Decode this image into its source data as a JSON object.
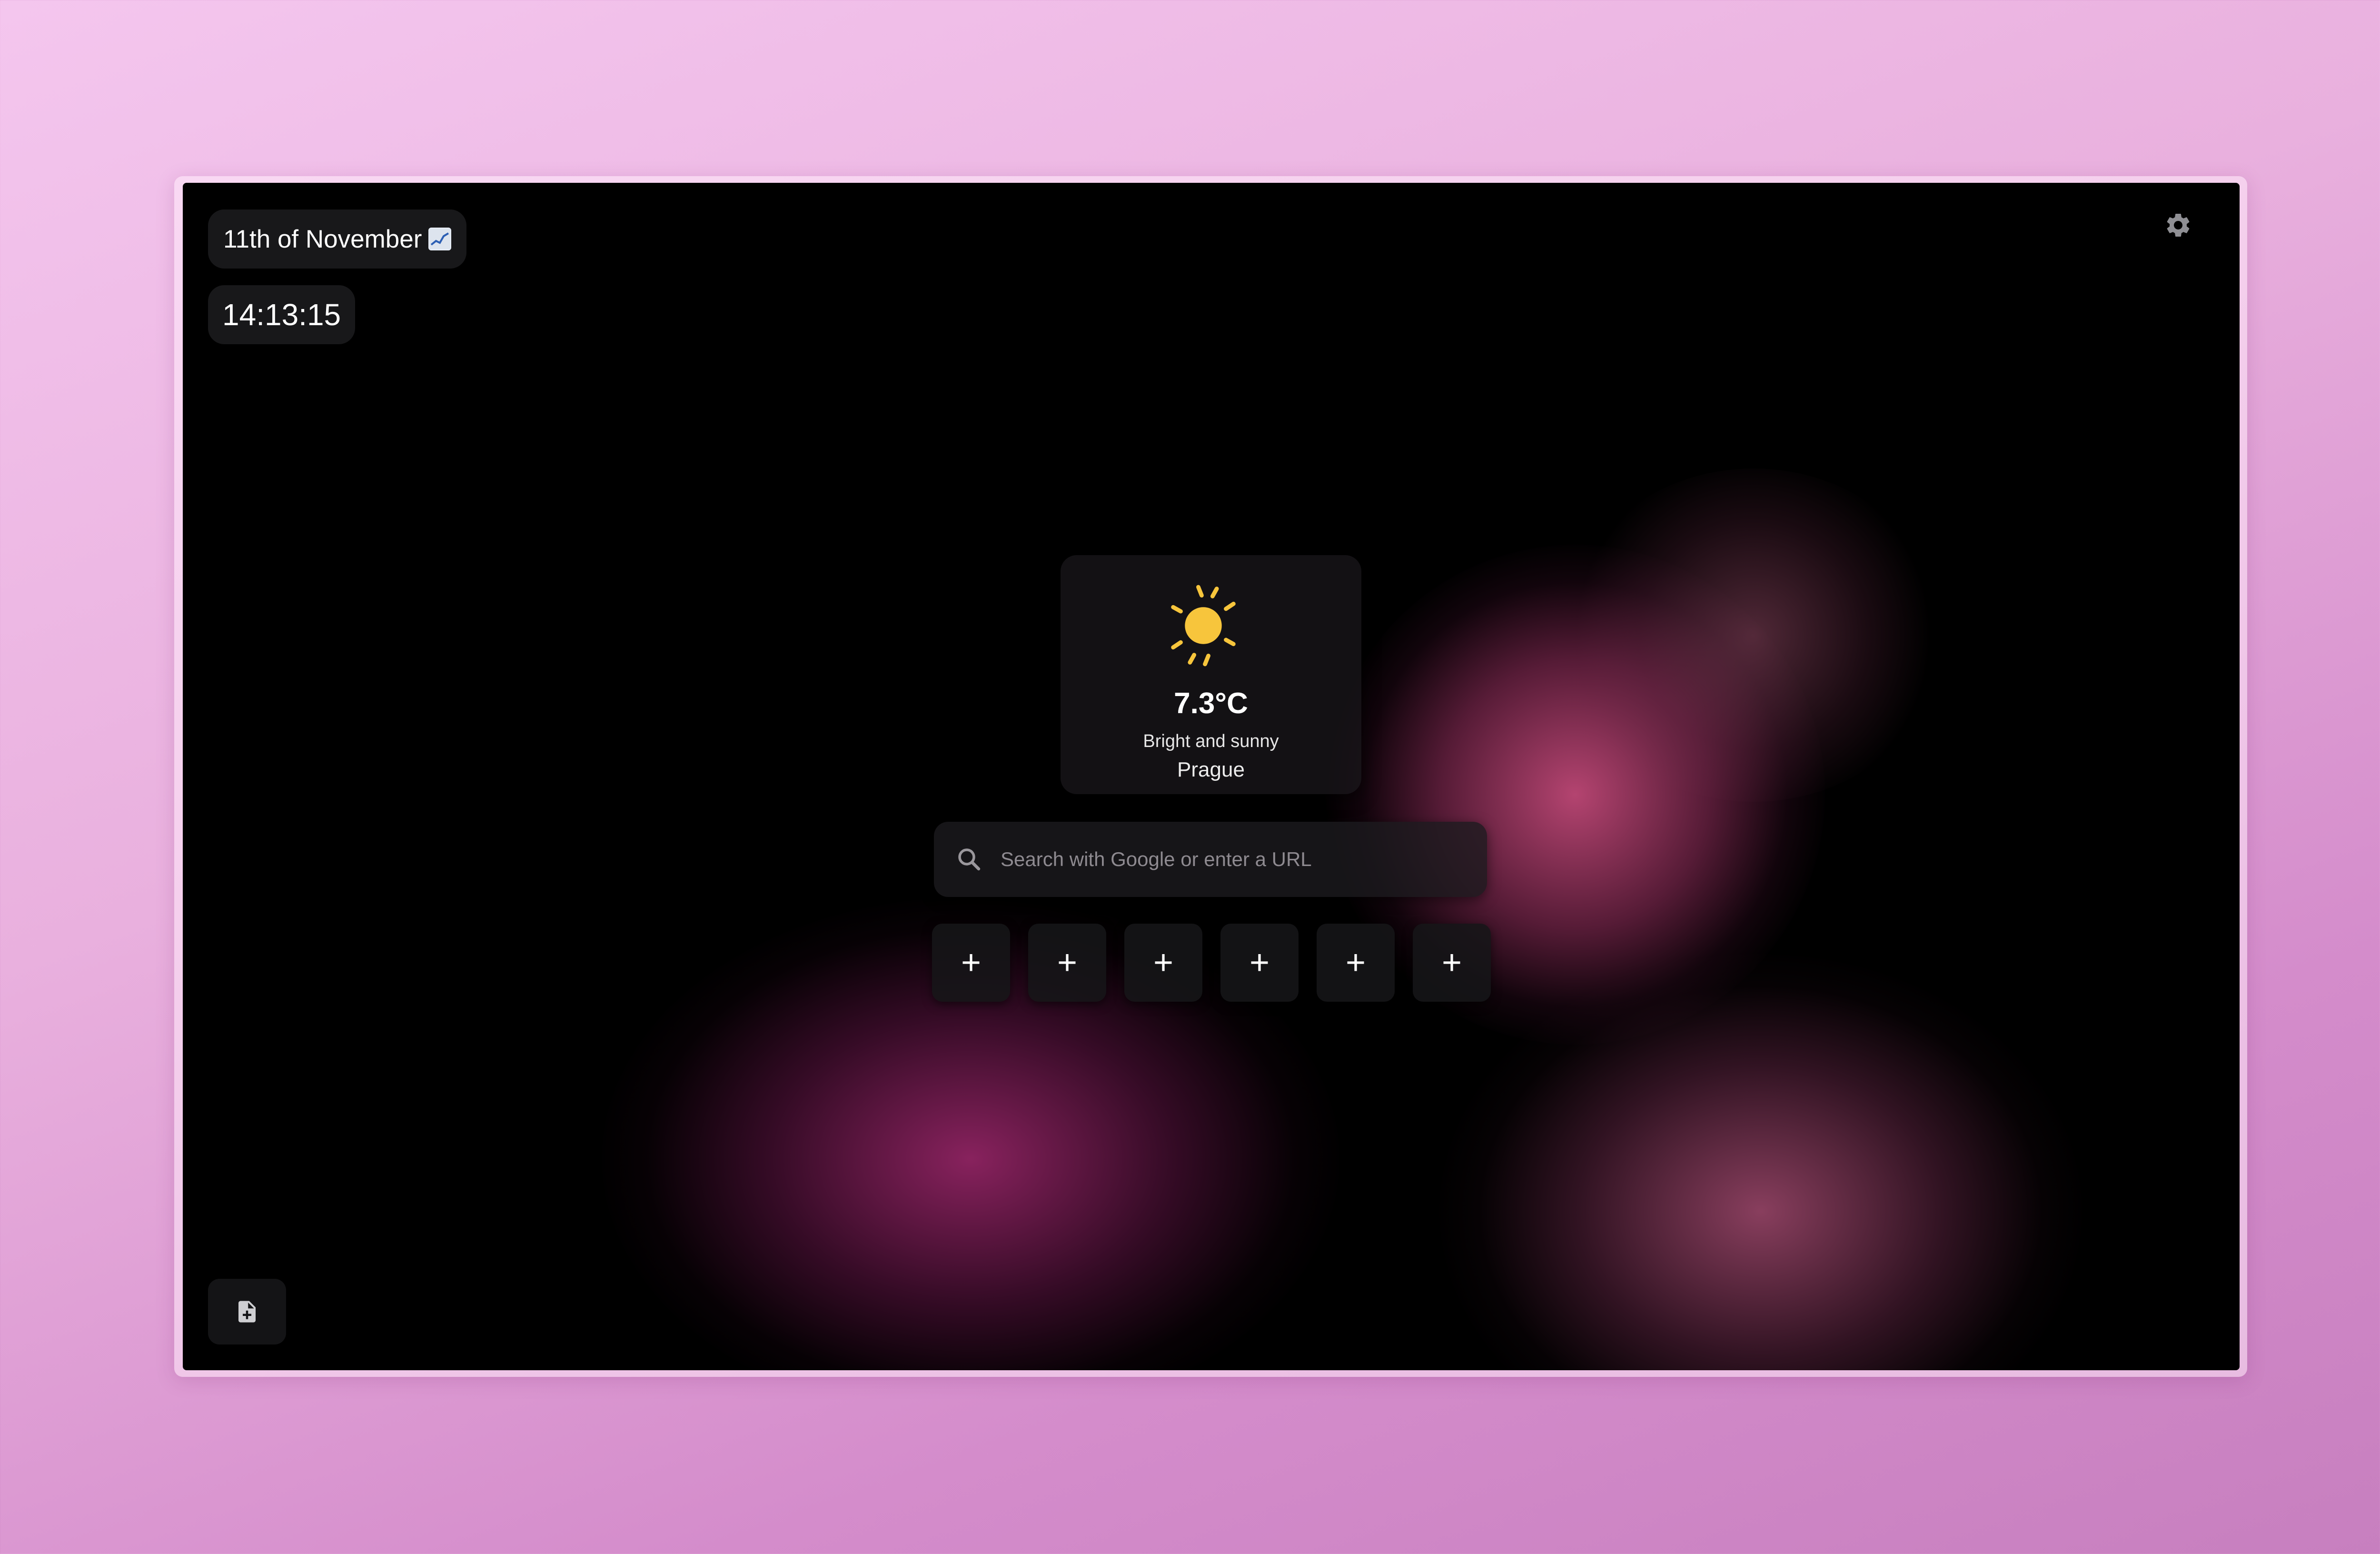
{
  "header": {
    "date": "11th of November",
    "date_icon": "chart-emoji-icon",
    "time": "14:13:15",
    "settings_icon": "gear-icon"
  },
  "weather": {
    "icon": "sun-icon",
    "temperature": "7.3°C",
    "description": "Bright and sunny",
    "city": "Prague"
  },
  "search": {
    "icon": "search-icon",
    "placeholder": "Search with Google or enter a URL",
    "value": ""
  },
  "shortcuts": [
    {
      "label": "+",
      "icon": "plus-icon"
    },
    {
      "label": "+",
      "icon": "plus-icon"
    },
    {
      "label": "+",
      "icon": "plus-icon"
    },
    {
      "label": "+",
      "icon": "plus-icon"
    },
    {
      "label": "+",
      "icon": "plus-icon"
    },
    {
      "label": "+",
      "icon": "plus-icon"
    }
  ],
  "footer": {
    "note_icon": "note-add-icon"
  },
  "colors": {
    "sun": "#f7c53c",
    "screen_background": "#000000",
    "backdrop_top": "#f4c6ee",
    "backdrop_bottom": "#c77fbf",
    "accent_glow": "#e1558c"
  }
}
